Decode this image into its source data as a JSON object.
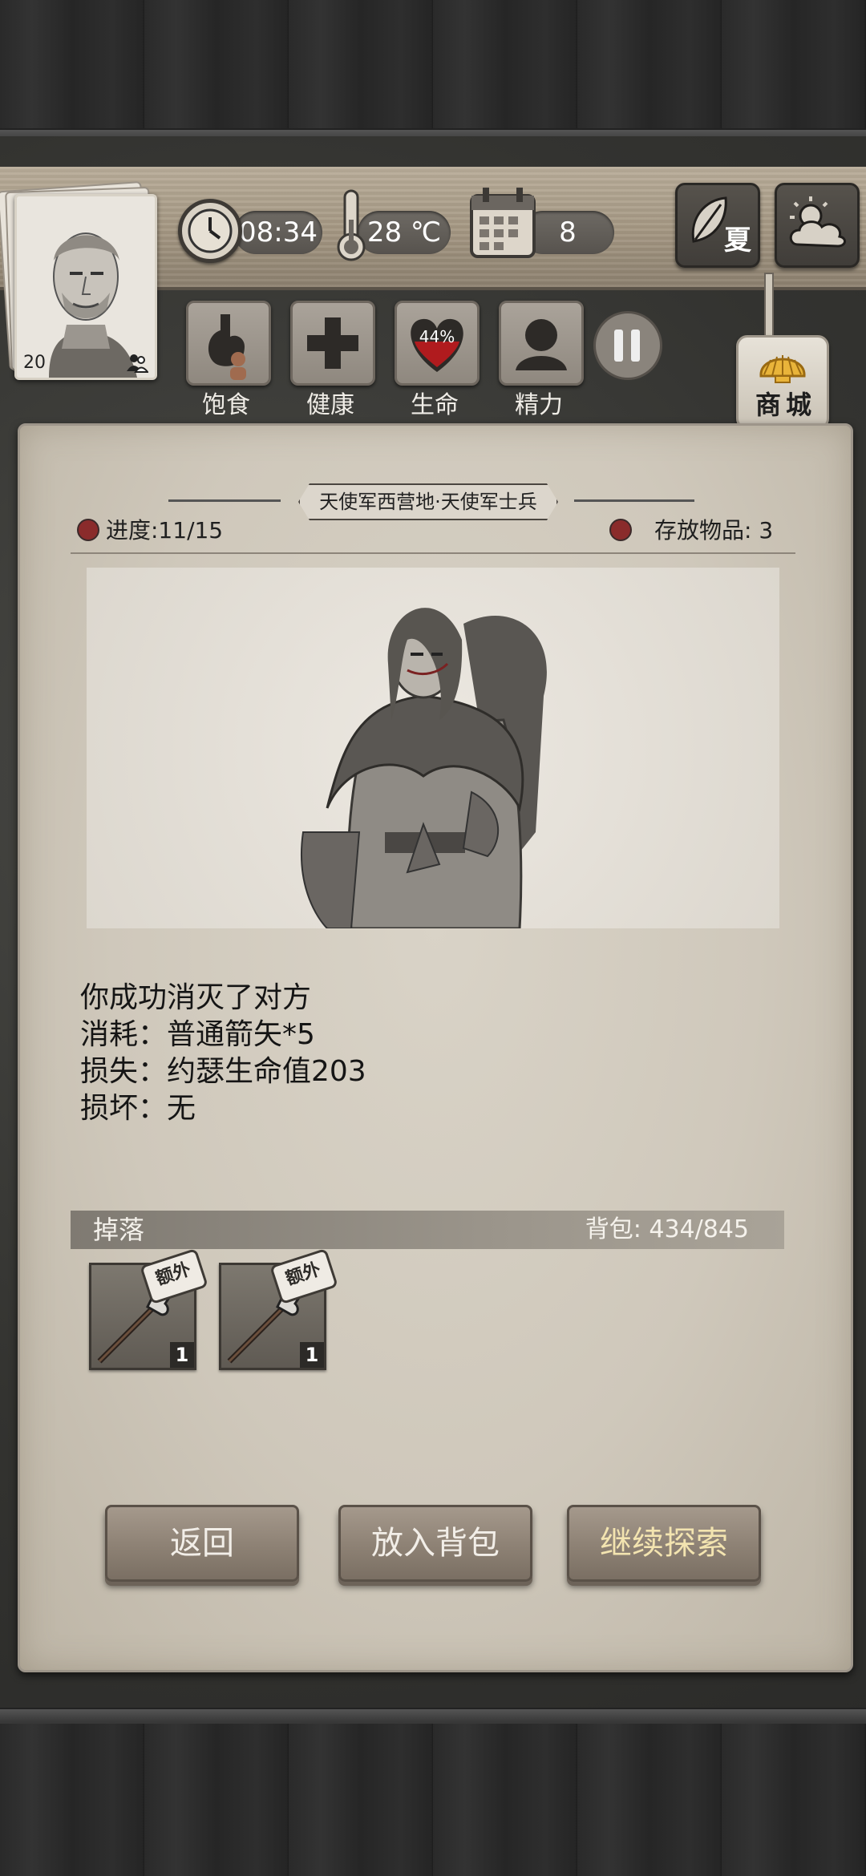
{
  "hud": {
    "time": "08:34",
    "temperature": "28 ℃",
    "day": "8",
    "season": "夏",
    "level": "20",
    "stats": [
      {
        "label": "饱食"
      },
      {
        "label": "健康"
      },
      {
        "label": "生命",
        "value": "44%"
      },
      {
        "label": "精力"
      }
    ],
    "shop_label": "商城"
  },
  "location": {
    "title": "天使军西营地·天使军士兵",
    "progress": "进度:11/15",
    "stored": "存放物品: 3"
  },
  "result": {
    "lines": [
      "你成功消灭了对方",
      "消耗：普通箭矢*5",
      "损失：约瑟生命值203",
      "损坏：无"
    ]
  },
  "drops": {
    "label": "掉落",
    "backpack": "背包: 434/845",
    "items": [
      {
        "icon": "halberd-icon",
        "tag": "额外",
        "qty": "1"
      },
      {
        "icon": "halberd-icon",
        "tag": "额外",
        "qty": "1"
      }
    ]
  },
  "buttons": {
    "back": "返回",
    "stash": "放入背包",
    "continue": "继续探索"
  },
  "colors": {
    "continue_text": "#f3e4b0",
    "button_text": "#f2eee8"
  }
}
